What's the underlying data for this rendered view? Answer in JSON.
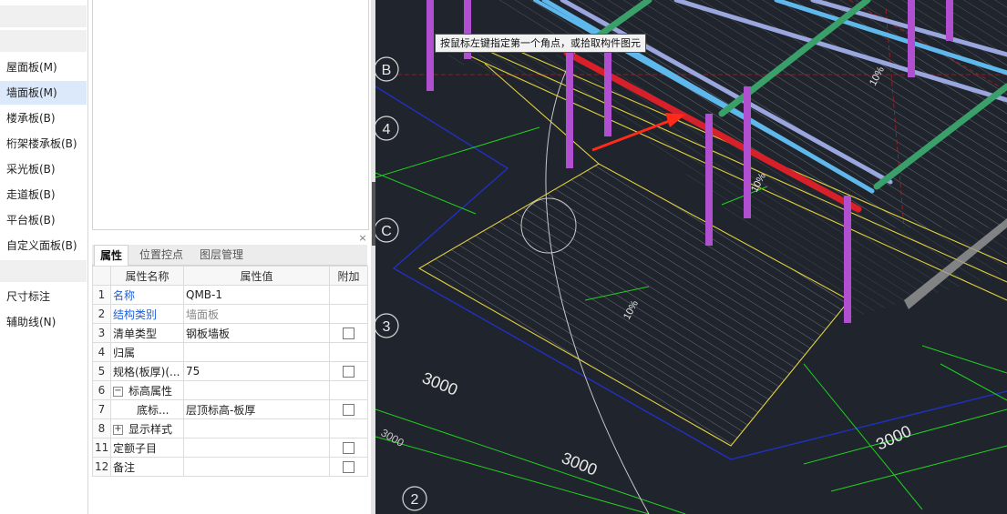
{
  "left_nav": {
    "items": [
      {
        "label": "屋面板(M)",
        "active": false
      },
      {
        "label": "墙面板(M)",
        "active": true
      },
      {
        "label": "楼承板(B)",
        "active": false
      },
      {
        "label": "桁架楼承板(B)",
        "active": false
      },
      {
        "label": "采光板(B)",
        "active": false
      },
      {
        "label": "走道板(B)",
        "active": false
      },
      {
        "label": "平台板(B)",
        "active": false
      },
      {
        "label": "自定义面板(B)",
        "active": false
      }
    ],
    "items2": [
      {
        "label": "尺寸标注"
      },
      {
        "label": "辅助线(N)"
      }
    ]
  },
  "panel": {
    "close_glyph": "×",
    "tabs": [
      {
        "label": "属性",
        "active": true
      },
      {
        "label": "位置控点",
        "active": false
      },
      {
        "label": "图层管理",
        "active": false
      }
    ],
    "grid_headers": {
      "name": "属性名称",
      "value": "属性值",
      "extra": "附加"
    },
    "rows": [
      {
        "num": "1",
        "name": "名称",
        "value": "QMB-1",
        "checkbox": false,
        "link": true,
        "muted": false
      },
      {
        "num": "2",
        "name": "结构类别",
        "value": "墙面板",
        "checkbox": false,
        "link": true,
        "muted": true
      },
      {
        "num": "3",
        "name": "清单类型",
        "value": "钢板墙板",
        "checkbox": true,
        "link": false,
        "muted": false
      },
      {
        "num": "4",
        "name": "归属",
        "value": "",
        "checkbox": false,
        "link": false,
        "muted": false
      },
      {
        "num": "5",
        "name": "规格(板厚)(...",
        "value": "75",
        "checkbox": true,
        "link": false,
        "muted": false
      },
      {
        "num": "6",
        "name": "标高属性",
        "value": "",
        "checkbox": false,
        "expander": "−",
        "link": false,
        "muted": false
      },
      {
        "num": "7",
        "name": "底标...",
        "value": "层顶标高-板厚",
        "checkbox": true,
        "child": true,
        "link": false,
        "muted": false
      },
      {
        "num": "8",
        "name": "显示样式",
        "value": "",
        "checkbox": false,
        "expander": "+",
        "link": false,
        "muted": false
      },
      {
        "num": "11",
        "name": "定额子目",
        "value": "",
        "checkbox": true,
        "link": false,
        "muted": false
      },
      {
        "num": "12",
        "name": "备注",
        "value": "",
        "checkbox": true,
        "link": false,
        "muted": false
      }
    ]
  },
  "viewport": {
    "tooltip": "按鼠标左键指定第一个角点，或拾取构件图元",
    "axis_labels": [
      "B",
      "4",
      "C",
      "3",
      "2"
    ],
    "dimensions": [
      "3000",
      "3000",
      "3000",
      "3000"
    ],
    "slope_labels": [
      "10%",
      "10%",
      "10%"
    ],
    "colors": {
      "background": "#20242c",
      "column": "#b04fd0",
      "purlin_blue": "#5fb8ec",
      "purlin_lavender": "#9aa6de",
      "beam_green": "#3aa06a",
      "beam_red": "#d8202a",
      "outline_yellow": "#e0d040",
      "outline_blue": "#2030c0",
      "dim_green": "#20d020",
      "arrow_red": "#ff2a1a"
    }
  }
}
